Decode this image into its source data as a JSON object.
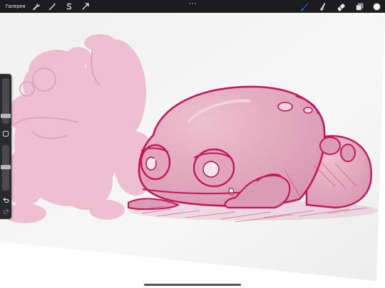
{
  "toolbar": {
    "gallery_label": "Галерея",
    "left_tools": [
      {
        "name": "actions-wrench-icon"
      },
      {
        "name": "adjustments-wand-icon"
      },
      {
        "name": "selection-s-icon"
      },
      {
        "name": "transform-arrow-icon"
      }
    ],
    "right_tools": [
      {
        "name": "brush-icon",
        "active": true
      },
      {
        "name": "smudge-icon",
        "active": false
      },
      {
        "name": "eraser-icon",
        "active": false
      },
      {
        "name": "layers-icon",
        "active": false
      }
    ],
    "current_color": "#ffffff",
    "active_tool_color": "#2f7cf6"
  },
  "sidebar": {
    "brush_size_level": 0.55,
    "opacity_level": 0.4
  },
  "canvas": {
    "ink_color": "#c2185b",
    "fill_color": "#e7a9bd",
    "reference_color": "#ecb6cb"
  }
}
